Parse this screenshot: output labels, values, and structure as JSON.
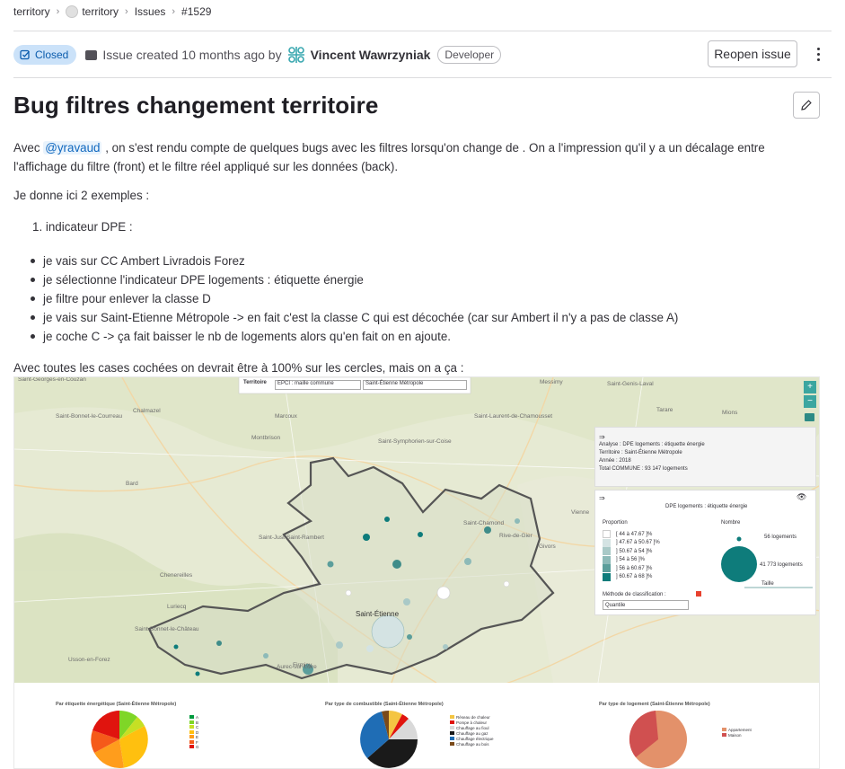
{
  "breadcrumb": {
    "items": [
      "territory",
      "territory",
      "Issues",
      "#1529"
    ]
  },
  "issue": {
    "status": "Closed",
    "created_text": "Issue created 10 months ago by",
    "author": "Vincent Wawrzyniak",
    "role": "Developer",
    "reopen_label": "Reopen issue",
    "title": "Bug filtres changement territoire"
  },
  "description": {
    "p1_pre": "Avec ",
    "mention": "@yravaud",
    "p1_post": " , on s'est rendu compte de quelques bugs avec les filtres lorsqu'on change de . On a l'impression qu'il y a un décalage entre l'affichage du filtre (front) et le filtre réel appliqué sur les données (back).",
    "p2": "Je donne ici 2 exemples :",
    "ol1": "1. indicateur DPE :",
    "bullets": [
      "je vais sur CC Ambert Livradois Forez",
      "je sélectionne l'indicateur DPE logements : étiquette énergie",
      "je filtre pour enlever la classe D",
      "je vais sur Saint-Etienne Métropole -> en fait c'est la classe C qui est décochée (car sur Ambert il n'y a pas de classe A)",
      "je coche C -> ça fait baisser le nb de logements alors qu'en fait on en ajoute."
    ],
    "p3": "Avec toutes les cases cochées on devrait être à 100% sur les cercles, mais on a ça :"
  },
  "embedded": {
    "map_places": [
      "Saint-Georges-en-Couzan",
      "Saint-Bonnet-le-Courreau",
      "Chalmazel",
      "Montbrison",
      "Bard",
      "Marcoux",
      "Saint-Just-Saint-Rambert",
      "Chenereilles",
      "Luriecq",
      "Saint-Bonnet-le-Château",
      "Usson-en-Forez",
      "Saint-Étienne",
      "Firminy",
      "Saint-Chamond",
      "Rive-de-Gier",
      "Tarare",
      "Mions",
      "Vienne",
      "Givors",
      "Saint-Symphorien-sur-Coise",
      "Aurec-sur-Loire",
      "Messimy",
      "Saint-Laurent-de-Chamousset",
      "Saint-Genis-Laval"
    ],
    "territoire_label": "Territoire",
    "territoire_select": "EPCI : maille commune",
    "territoire_value": "Saint-Étienne Métropole",
    "info_analyse": "Analyse : DPE logements : étiquette énergie",
    "info_territoire": "Territoire : Saint-Étienne Métropole",
    "info_annee": "Année : 2018",
    "info_total": "Total COMMUNE : 93 147 logements",
    "legend_title": "DPE logements : étiquette énergie",
    "legend_proportion": "Proportion",
    "legend_nombre": "Nombre",
    "legend_ranges": [
      "[ 44  à  47.67 ]%",
      "] 47.67  à  50.67 ]%",
      "] 50.67  à  54 ]%",
      "] 54  à  56 ]%",
      "] 56  à  60.67 ]%",
      "] 60.67  à  68 ]%"
    ],
    "legend_counts": [
      "56 logements",
      "41 773 logements"
    ],
    "legend_taille": "Taille",
    "legend_methode": "Méthode de classification :",
    "legend_method_value": "Quantile",
    "pie_titles": [
      "Par étiquette énergétique (Saint-Étienne Métropole)",
      "Par type de combustible (Saint-Étienne Métropole)",
      "Par type de logement (Saint-Étienne Métropole)"
    ],
    "pie1_legend": [
      "A",
      "B",
      "C",
      "D",
      "E",
      "F",
      "G"
    ],
    "pie2_legend": [
      "Réseau de chaleur",
      "Pompe à chaleur",
      "Chauffage au fioul",
      "Chauffage au gaz",
      "Chauffage électrique",
      "Chauffage au bois"
    ],
    "pie3_legend": [
      "Appartement",
      "Maison"
    ]
  },
  "colors": {
    "accent": "#1068bf",
    "closed_bg": "#cbe2f9",
    "teal": "#0e7c7b",
    "map_bg": "#e8ecd8"
  }
}
